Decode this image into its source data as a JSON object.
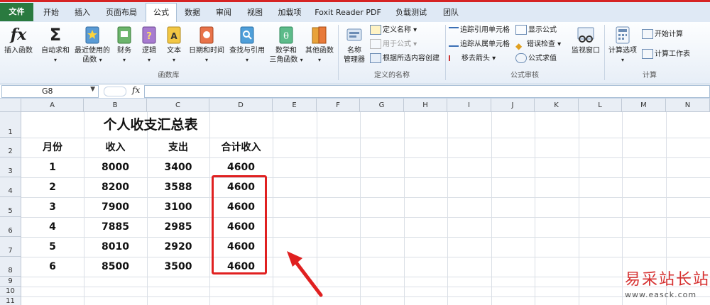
{
  "tabs": {
    "file": "文件",
    "items": [
      "开始",
      "插入",
      "页面布局",
      "公式",
      "数据",
      "审阅",
      "视图",
      "加载项",
      "Foxit Reader PDF",
      "负载测试",
      "团队"
    ],
    "active": "公式"
  },
  "ribbon": {
    "insert_function": "插入函数",
    "autosum": "自动求和",
    "recent_1": "最近使用的",
    "recent_2": "函数",
    "financial": "财务",
    "logical": "逻辑",
    "text": "文本",
    "datetime": "日期和时间",
    "lookup": "查找与引用",
    "math_1": "数学和",
    "math_2": "三角函数",
    "other": "其他函数",
    "group_library": "函数库",
    "name_mgr_1": "名称",
    "name_mgr_2": "管理器",
    "define_name": "定义名称",
    "use_in_formula": "用于公式",
    "create_from_sel": "根据所选内容创建",
    "group_names": "定义的名称",
    "trace_precedents": "追踪引用单元格",
    "trace_dependents": "追踪从属单元格",
    "remove_arrows": "移去箭头",
    "show_formulas": "显示公式",
    "error_check": "错误检查",
    "eval_formula": "公式求值",
    "watch_window": "监视窗口",
    "group_audit": "公式审核",
    "calc_options": "计算选项",
    "calc_now": "开始计算",
    "calc_sheet": "计算工作表",
    "group_calc": "计算"
  },
  "formula_bar": {
    "cell_ref": "G8",
    "fx": "fx",
    "value": ""
  },
  "columns": [
    "A",
    "B",
    "C",
    "D",
    "E",
    "F",
    "G",
    "H",
    "I",
    "J",
    "K",
    "L",
    "M",
    "N"
  ],
  "rows": [
    "1",
    "2",
    "3",
    "4",
    "5",
    "6",
    "7",
    "8",
    "9",
    "10",
    "11"
  ],
  "sheet": {
    "title": "个人收支汇总表",
    "headers": [
      "月份",
      "收入",
      "支出",
      "合计收入"
    ],
    "data": [
      [
        "1",
        "8000",
        "3400",
        "4600"
      ],
      [
        "2",
        "8200",
        "3588",
        "4600"
      ],
      [
        "3",
        "7900",
        "3100",
        "4600"
      ],
      [
        "4",
        "7885",
        "2985",
        "4600"
      ],
      [
        "5",
        "8010",
        "2920",
        "4600"
      ],
      [
        "6",
        "8500",
        "3500",
        "4600"
      ]
    ]
  },
  "watermark": {
    "line1": "易采站长站",
    "line2": "www.easck.com"
  },
  "colors": {
    "highlight": "#e02020",
    "file_tab": "#2a7a3f"
  }
}
